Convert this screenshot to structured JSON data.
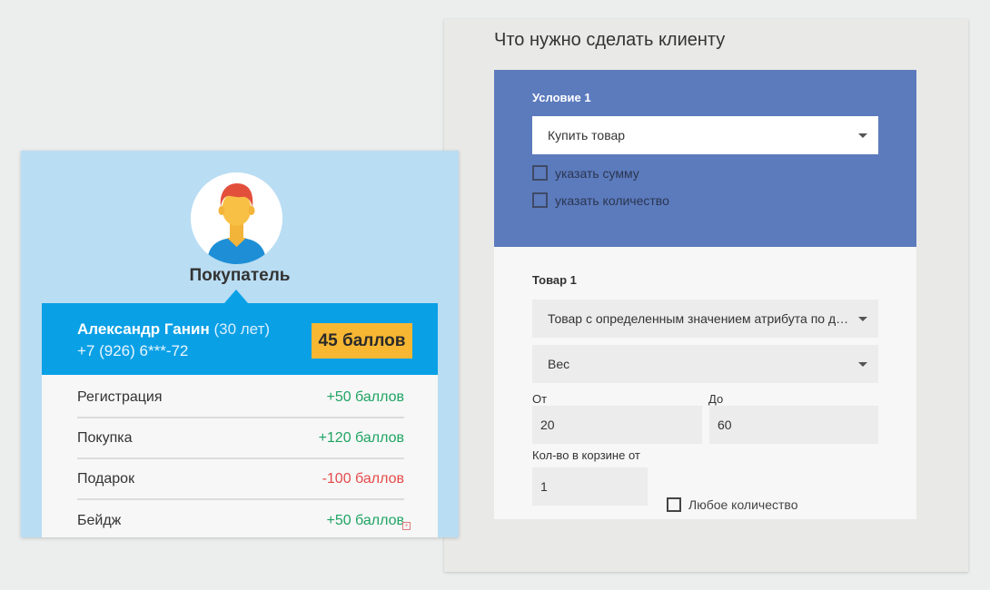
{
  "task_panel": {
    "title": "Что нужно сделать клиенту",
    "condition": {
      "label": "Условие 1",
      "action_select": "Купить товар",
      "checkbox_sum": "указать сумму",
      "checkbox_quantity": "указать количество"
    },
    "product": {
      "label": "Товар 1",
      "type_select": "Товар с определенным значением атрибута по диапазону",
      "attribute_select": "Вес",
      "from_label": "От",
      "from_value": "20",
      "to_label": "До",
      "to_value": "60",
      "cart_qty_label": "Кол-во в корзине от",
      "cart_qty_value": "1",
      "any_quantity_label": "Любое количество"
    }
  },
  "customer_card": {
    "role": "Покупатель",
    "name": "Александр Ганин",
    "age": "(30 лет)",
    "phone": "+7 (926) 6***-72",
    "points": "45 баллов",
    "events": [
      {
        "label": "Регистрация",
        "value": "+50 баллов",
        "type": "positive"
      },
      {
        "label": "Покупка",
        "value": "+120 баллов",
        "type": "positive"
      },
      {
        "label": "Подарок",
        "value": "-100 баллов",
        "type": "negative"
      },
      {
        "label": "Бейдж",
        "value": "+50 баллов",
        "type": "positive"
      }
    ]
  },
  "colors": {
    "condition_bg": "#5c7bbd",
    "info_bar": "#0aa0e6",
    "badge": "#f7b733",
    "positive": "#1fa463",
    "negative": "#e54b4b",
    "card_bg": "#b9ddf3"
  },
  "icons": {
    "avatar": "user-avatar-icon",
    "dropdown": "chevron-down-icon"
  }
}
